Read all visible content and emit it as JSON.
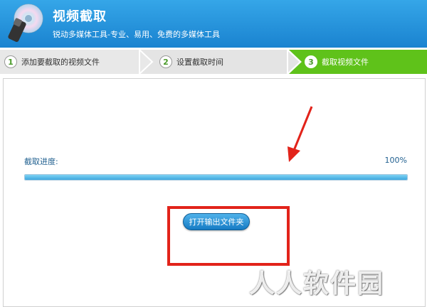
{
  "header": {
    "title": "视频截取",
    "subtitle": "锐动多媒体工具-专业、易用、免费的多媒体工具"
  },
  "steps": [
    {
      "num": "1",
      "label": "添加要截取的视频文件"
    },
    {
      "num": "2",
      "label": "设置截取时间"
    },
    {
      "num": "3",
      "label": "截取视频文件"
    }
  ],
  "progress": {
    "label": "截取进度:",
    "value_text": "100%",
    "fraction": 1.0
  },
  "open_folder_button": "打开输出文件夹",
  "watermark": "人人软件园",
  "colors": {
    "header": "#1a83d0",
    "active_step": "#5fc21a",
    "progress_fill": "#3ea8de",
    "annotation": "#e2231a"
  }
}
